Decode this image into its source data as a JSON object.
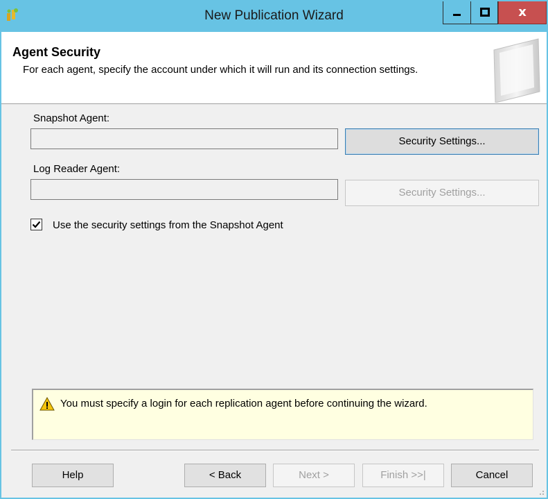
{
  "window": {
    "title": "New Publication Wizard",
    "minimize_glyph": "",
    "maximize_glyph": "",
    "close_glyph": "x"
  },
  "header": {
    "title": "Agent Security",
    "description": "For each agent, specify the account under which it will run and its connection settings."
  },
  "snapshot_agent": {
    "label": "Snapshot Agent:",
    "value": "",
    "button_label": "Security Settings..."
  },
  "log_reader_agent": {
    "label": "Log Reader Agent:",
    "value": "",
    "button_label": "Security Settings..."
  },
  "use_snapshot_settings": {
    "label": "Use the security settings from the Snapshot Agent",
    "checked": true
  },
  "warning": {
    "icon": "warning-icon",
    "text": "You must specify a login for each replication agent before continuing the wizard."
  },
  "footer": {
    "help_label": "Help",
    "back_label": "< Back",
    "next_label": "Next >",
    "finish_label": "Finish >>|",
    "cancel_label": "Cancel"
  },
  "colors": {
    "titlebar": "#67c3e4",
    "close_button": "#c75050",
    "warning_background": "#ffffe1"
  }
}
